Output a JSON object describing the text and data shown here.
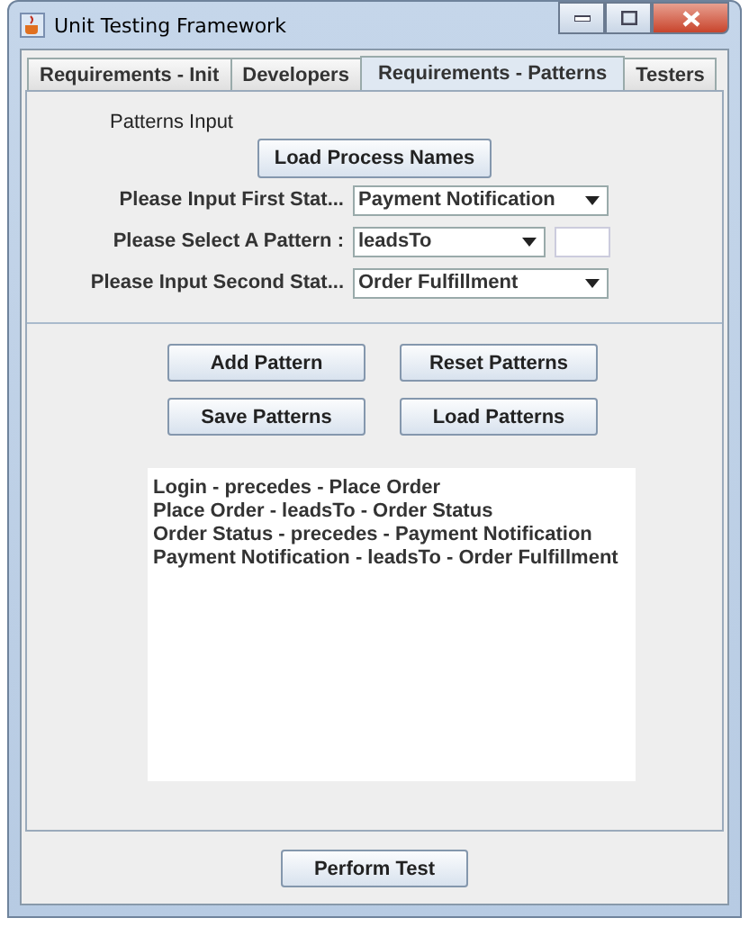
{
  "window": {
    "title": "Unit Testing Framework"
  },
  "tabs": [
    {
      "label": "Requirements - Init",
      "selected": false
    },
    {
      "label": "Developers",
      "selected": false
    },
    {
      "label": "Requirements - Patterns",
      "selected": true
    },
    {
      "label": "Testers",
      "selected": false
    }
  ],
  "section_label": "Patterns Input",
  "load_names_button": "Load Process Names",
  "inputs": [
    {
      "label": "Please Input First Stat...",
      "value": "Payment Notification",
      "kind": "combo"
    },
    {
      "label": "Please Select A Pattern :",
      "value": "leadsTo",
      "kind": "combo-extra"
    },
    {
      "label": "Please Input Second Stat...",
      "value": "Order Fulfillment",
      "kind": "combo"
    }
  ],
  "pattern_buttons": [
    [
      "Add Pattern",
      "Reset Patterns"
    ],
    [
      "Save Patterns",
      "Load Patterns"
    ]
  ],
  "patterns_list": [
    "Login - precedes - Place Order",
    "Place Order - leadsTo - Order Status",
    "Order Status - precedes - Payment Notification",
    "Payment Notification - leadsTo - Order Fulfillment"
  ],
  "perform_button": "Perform Test"
}
